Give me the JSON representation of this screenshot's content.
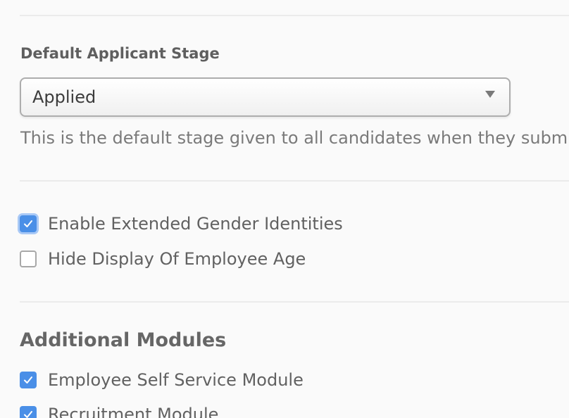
{
  "applicant_stage": {
    "label": "Default Applicant Stage",
    "selected_value": "Applied",
    "help_text": "This is the default stage given to all candidates when they submit"
  },
  "options": [
    {
      "label": "Enable Extended Gender Identities",
      "checked": true
    },
    {
      "label": "Hide Display Of Employee Age",
      "checked": false
    }
  ],
  "additional_modules": {
    "heading": "Additional Modules",
    "items": [
      {
        "label": "Employee Self Service Module",
        "checked": true
      },
      {
        "label": "Recruitment Module",
        "checked": true
      }
    ]
  },
  "colors": {
    "checkbox_checked": "#4a8fe7",
    "checkbox_focus_ring": "#a9c9f6",
    "text": "#616161",
    "divider": "#ebebeb"
  }
}
